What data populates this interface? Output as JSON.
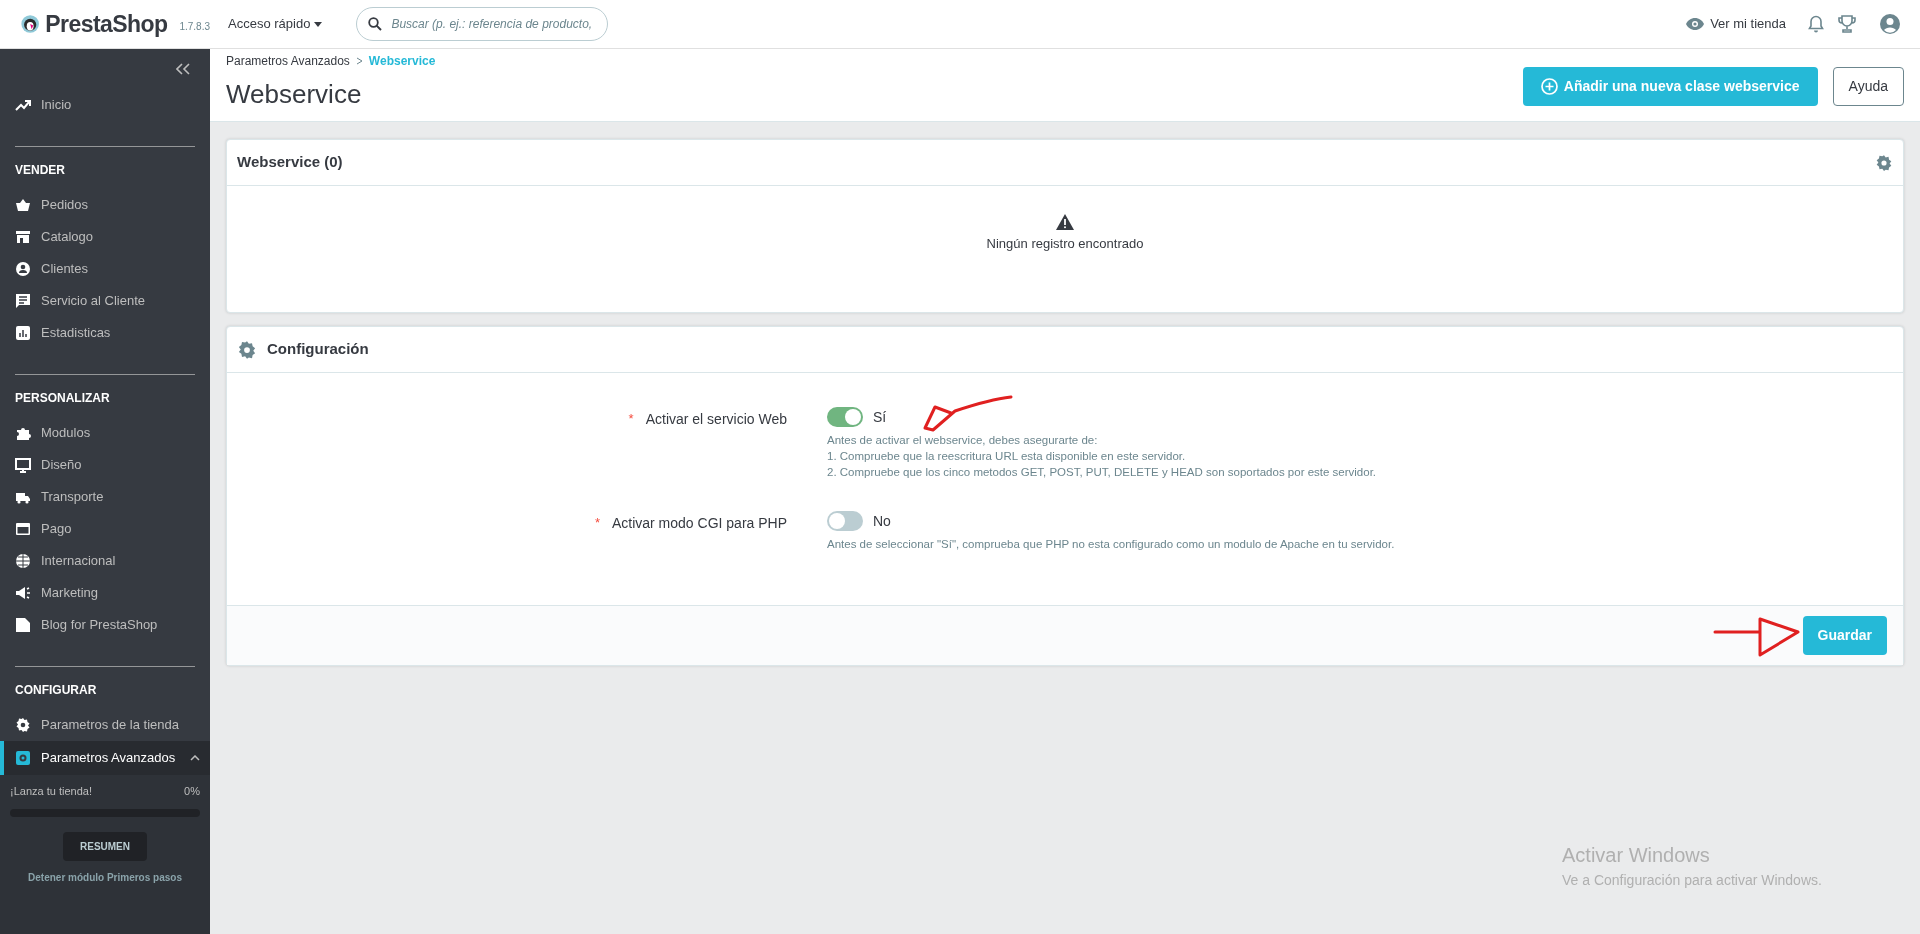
{
  "header": {
    "brand": "PrestaShop",
    "version": "1.7.8.3",
    "quick_access": "Acceso rápido",
    "search": {
      "placeholder": "Buscar (p. ej.: referencia de producto,"
    },
    "view_store": "Ver mi tienda"
  },
  "sidebar": {
    "home": {
      "label": "Inicio",
      "selected": false
    },
    "sections": [
      {
        "title": "VENDER",
        "items": [
          {
            "label": "Pedidos",
            "selected": false
          },
          {
            "label": "Catalogo",
            "selected": false
          },
          {
            "label": "Clientes",
            "selected": false
          },
          {
            "label": "Servicio al Cliente",
            "selected": false
          },
          {
            "label": "Estadisticas",
            "selected": false
          }
        ]
      },
      {
        "title": "PERSONALIZAR",
        "items": [
          {
            "label": "Modulos",
            "selected": false
          },
          {
            "label": "Diseño",
            "selected": false
          },
          {
            "label": "Transporte",
            "selected": false
          },
          {
            "label": "Pago",
            "selected": false
          },
          {
            "label": "Internacional",
            "selected": false
          },
          {
            "label": "Marketing",
            "selected": false
          },
          {
            "label": "Blog for PrestaShop",
            "selected": false
          }
        ]
      },
      {
        "title": "CONFIGURAR",
        "items": [
          {
            "label": "Parametros de la tienda",
            "selected": false
          },
          {
            "label": "Parametros Avanzados",
            "selected": true,
            "expanded": true
          }
        ]
      }
    ],
    "onboarding": {
      "label": "¡Lanza tu tienda!",
      "percent": "0%",
      "level": 0,
      "button": "RESUMEN",
      "link": "Detener módulo Primeros pasos"
    }
  },
  "breadcrumb": [
    "Parametros Avanzados",
    "Webservice"
  ],
  "page_title": "Webservice",
  "actions": [
    {
      "label": "Añadir una nueva clase webservice",
      "kind": "primary"
    },
    {
      "label": "Ayuda",
      "kind": "outline"
    }
  ],
  "list_panel": {
    "title": "Webservice (0)",
    "empty_message": "Ningún registro encontrado"
  },
  "config_panel": {
    "title": "Configuración",
    "fields": [
      {
        "label": "Activar el servicio Web",
        "required_mark": "*",
        "on": true,
        "value_label": "Sí",
        "help": [
          "Antes de activar el webservice, debes asegurarte de:",
          "1. Compruebe que la reescritura URL esta disponible en este servidor.",
          "2. Compruebe que los cinco metodos GET, POST, PUT, DELETE y HEAD son soportados por este servidor."
        ]
      },
      {
        "label": "Activar modo CGI para PHP",
        "required_mark": "*",
        "on": false,
        "value_label": "No",
        "help": [
          "Antes de seleccionar \"Sí\", comprueba que PHP no esta configurado como un modulo de Apache en tu servidor."
        ]
      }
    ],
    "save": "Guardar"
  },
  "os_overlay": {
    "title": "Activar Windows",
    "subtitle": "Ve a Configuración para activar Windows."
  }
}
